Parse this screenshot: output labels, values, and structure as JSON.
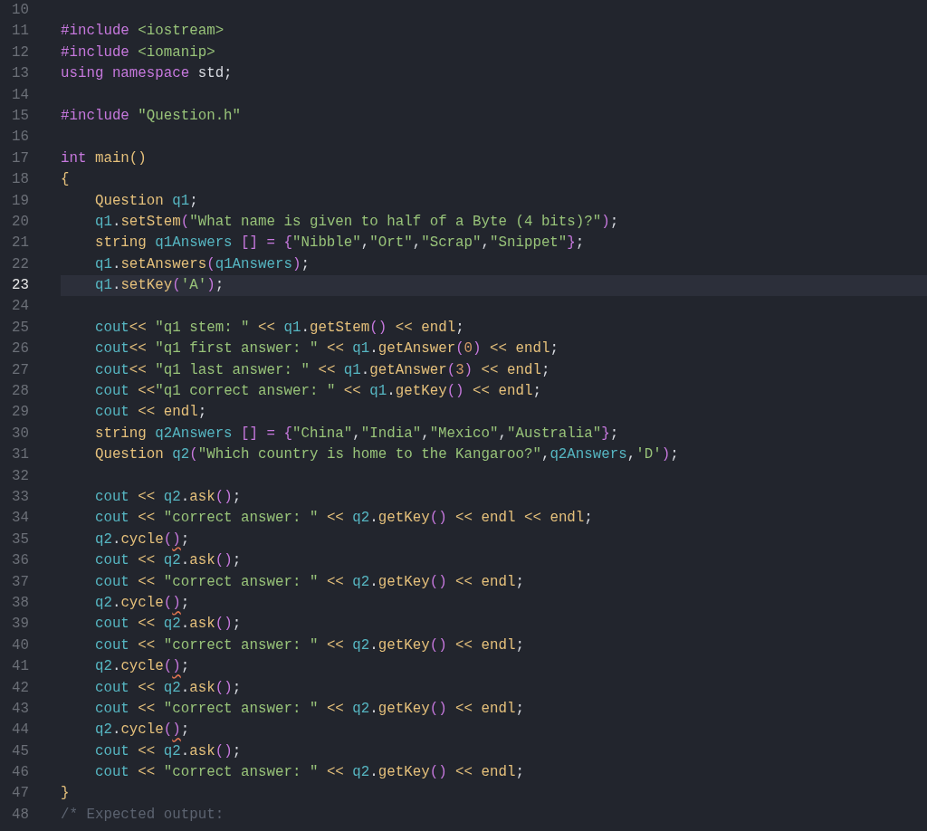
{
  "editor": {
    "lines": [
      {
        "number": "10",
        "current": false
      },
      {
        "number": "11",
        "current": false,
        "tokens": [
          {
            "kind": "kw",
            "text": "#include"
          },
          {
            "kind": "str",
            "text": " <iostream>"
          }
        ]
      },
      {
        "number": "12",
        "current": false,
        "tokens": [
          {
            "kind": "kw",
            "text": "#include"
          },
          {
            "kind": "str",
            "text": " <iomanip>"
          }
        ]
      },
      {
        "number": "13",
        "current": false,
        "tokens": [
          {
            "kind": "kw",
            "text": "using namespace"
          },
          {
            "kind": "pl",
            "text": " std;"
          }
        ]
      },
      {
        "number": "14",
        "current": false
      },
      {
        "number": "15",
        "current": false,
        "tokens": [
          {
            "kind": "kw",
            "text": "#include"
          },
          {
            "kind": "str",
            "text": " \"Question.h\""
          }
        ]
      },
      {
        "number": "16",
        "current": false
      },
      {
        "number": "17",
        "current": false,
        "tokens": [
          {
            "kind": "kw",
            "text": "int"
          },
          {
            "kind": "fn",
            "text": " main()"
          }
        ]
      },
      {
        "number": "18",
        "current": false,
        "tokens": [
          {
            "kind": "fn",
            "text": "{"
          }
        ]
      },
      {
        "number": "19",
        "current": false,
        "tokens": [
          {
            "kind": "type",
            "text": "    Question"
          },
          {
            "kind": "var",
            "text": " q1"
          },
          {
            "kind": "pl",
            "text": ";"
          }
        ]
      },
      {
        "number": "20",
        "current": false,
        "tokens": [
          {
            "kind": "var",
            "text": "    q1"
          },
          {
            "kind": "pl",
            "text": "."
          },
          {
            "kind": "fn",
            "text": "setStem"
          },
          {
            "kind": "par",
            "text": "("
          },
          {
            "kind": "str",
            "text": "\"What name is given to half of a Byte (4 bits)?\""
          },
          {
            "kind": "par",
            "text": ")"
          },
          {
            "kind": "pl",
            "text": ";"
          }
        ]
      },
      {
        "number": "21",
        "current": false,
        "tokens": [
          {
            "kind": "type",
            "text": "    string"
          },
          {
            "kind": "var",
            "text": " q1Answers"
          },
          {
            "kind": "par",
            "text": " [] = {"
          },
          {
            "kind": "str",
            "text": "\"Nibble\""
          },
          {
            "kind": "pl",
            "text": ","
          },
          {
            "kind": "str",
            "text": "\"Ort\""
          },
          {
            "kind": "pl",
            "text": ","
          },
          {
            "kind": "str",
            "text": "\"Scrap\""
          },
          {
            "kind": "pl",
            "text": ","
          },
          {
            "kind": "str",
            "text": "\"Snippet\""
          },
          {
            "kind": "par",
            "text": "}"
          },
          {
            "kind": "pl",
            "text": ";"
          }
        ]
      },
      {
        "number": "22",
        "current": false,
        "tokens": [
          {
            "kind": "var",
            "text": "    q1"
          },
          {
            "kind": "pl",
            "text": "."
          },
          {
            "kind": "fn",
            "text": "setAnswers"
          },
          {
            "kind": "par",
            "text": "("
          },
          {
            "kind": "var",
            "text": "q1Answers"
          },
          {
            "kind": "par",
            "text": ")"
          },
          {
            "kind": "pl",
            "text": ";"
          }
        ]
      },
      {
        "number": "23",
        "current": true,
        "tokens": [
          {
            "kind": "var",
            "text": "    q1"
          },
          {
            "kind": "pl",
            "text": "."
          },
          {
            "kind": "fn",
            "text": "setKey"
          },
          {
            "kind": "par",
            "text": "("
          },
          {
            "kind": "str",
            "text": "'A'"
          },
          {
            "kind": "par",
            "text": ")"
          },
          {
            "kind": "pl",
            "text": ";"
          }
        ]
      },
      {
        "number": "24",
        "current": false
      },
      {
        "number": "25",
        "current": false,
        "tokens": [
          {
            "kind": "var",
            "text": "    cout"
          },
          {
            "kind": "op",
            "text": "<< "
          },
          {
            "kind": "str",
            "text": "\"q1 stem: \""
          },
          {
            "kind": "op",
            "text": " << "
          },
          {
            "kind": "var",
            "text": "q1"
          },
          {
            "kind": "pl",
            "text": "."
          },
          {
            "kind": "fn",
            "text": "getStem"
          },
          {
            "kind": "par",
            "text": "()"
          },
          {
            "kind": "op",
            "text": " << endl"
          },
          {
            "kind": "pl",
            "text": ";"
          }
        ]
      },
      {
        "number": "26",
        "current": false,
        "tokens": [
          {
            "kind": "var",
            "text": "    cout"
          },
          {
            "kind": "op",
            "text": "<< "
          },
          {
            "kind": "str",
            "text": "\"q1 first answer: \""
          },
          {
            "kind": "op",
            "text": " << "
          },
          {
            "kind": "var",
            "text": "q1"
          },
          {
            "kind": "pl",
            "text": "."
          },
          {
            "kind": "fn",
            "text": "getAnswer"
          },
          {
            "kind": "par",
            "text": "("
          },
          {
            "kind": "num",
            "text": "0"
          },
          {
            "kind": "par",
            "text": ")"
          },
          {
            "kind": "op",
            "text": " << endl"
          },
          {
            "kind": "pl",
            "text": ";"
          }
        ]
      },
      {
        "number": "27",
        "current": false,
        "tokens": [
          {
            "kind": "var",
            "text": "    cout"
          },
          {
            "kind": "op",
            "text": "<< "
          },
          {
            "kind": "str",
            "text": "\"q1 last answer: \""
          },
          {
            "kind": "op",
            "text": " << "
          },
          {
            "kind": "var",
            "text": "q1"
          },
          {
            "kind": "pl",
            "text": "."
          },
          {
            "kind": "fn",
            "text": "getAnswer"
          },
          {
            "kind": "par",
            "text": "("
          },
          {
            "kind": "num",
            "text": "3"
          },
          {
            "kind": "par",
            "text": ")"
          },
          {
            "kind": "op",
            "text": " << endl"
          },
          {
            "kind": "pl",
            "text": ";"
          }
        ]
      },
      {
        "number": "28",
        "current": false,
        "tokens": [
          {
            "kind": "var",
            "text": "    cout"
          },
          {
            "kind": "op",
            "text": " <<"
          },
          {
            "kind": "str",
            "text": "\"q1 correct answer: \""
          },
          {
            "kind": "op",
            "text": " << "
          },
          {
            "kind": "var",
            "text": "q1"
          },
          {
            "kind": "pl",
            "text": "."
          },
          {
            "kind": "fn",
            "text": "getKey"
          },
          {
            "kind": "par",
            "text": "()"
          },
          {
            "kind": "op",
            "text": " << endl"
          },
          {
            "kind": "pl",
            "text": ";"
          }
        ]
      },
      {
        "number": "29",
        "current": false,
        "tokens": [
          {
            "kind": "var",
            "text": "    cout"
          },
          {
            "kind": "op",
            "text": " << endl"
          },
          {
            "kind": "pl",
            "text": ";"
          }
        ]
      },
      {
        "number": "30",
        "current": false,
        "tokens": [
          {
            "kind": "type",
            "text": "    string"
          },
          {
            "kind": "var",
            "text": " q2Answers"
          },
          {
            "kind": "par",
            "text": " [] = {"
          },
          {
            "kind": "str",
            "text": "\"China\""
          },
          {
            "kind": "pl",
            "text": ","
          },
          {
            "kind": "str",
            "text": "\"India\""
          },
          {
            "kind": "pl",
            "text": ","
          },
          {
            "kind": "str",
            "text": "\"Mexico\""
          },
          {
            "kind": "pl",
            "text": ","
          },
          {
            "kind": "str",
            "text": "\"Australia\""
          },
          {
            "kind": "par",
            "text": "}"
          },
          {
            "kind": "pl",
            "text": ";"
          }
        ]
      },
      {
        "number": "31",
        "current": false,
        "tokens": [
          {
            "kind": "type",
            "text": "    Question"
          },
          {
            "kind": "var",
            "text": " q2"
          },
          {
            "kind": "par",
            "text": "("
          },
          {
            "kind": "str",
            "text": "\"Which country is home to the Kangaroo?\""
          },
          {
            "kind": "pl",
            "text": ","
          },
          {
            "kind": "var",
            "text": "q2Answers"
          },
          {
            "kind": "pl",
            "text": ","
          },
          {
            "kind": "str",
            "text": "'D'"
          },
          {
            "kind": "par",
            "text": ")"
          },
          {
            "kind": "pl",
            "text": ";"
          }
        ]
      },
      {
        "number": "32",
        "current": false
      },
      {
        "number": "33",
        "current": false,
        "tokens": [
          {
            "kind": "var",
            "text": "    cout"
          },
          {
            "kind": "op",
            "text": " << "
          },
          {
            "kind": "var",
            "text": "q2"
          },
          {
            "kind": "pl",
            "text": "."
          },
          {
            "kind": "fn",
            "text": "ask"
          },
          {
            "kind": "par",
            "text": "()"
          },
          {
            "kind": "pl",
            "text": ";"
          }
        ]
      },
      {
        "number": "34",
        "current": false,
        "tokens": [
          {
            "kind": "var",
            "text": "    cout"
          },
          {
            "kind": "op",
            "text": " << "
          },
          {
            "kind": "str",
            "text": "\"correct answer: \""
          },
          {
            "kind": "op",
            "text": " << "
          },
          {
            "kind": "var",
            "text": "q2"
          },
          {
            "kind": "pl",
            "text": "."
          },
          {
            "kind": "fn",
            "text": "getKey"
          },
          {
            "kind": "par",
            "text": "()"
          },
          {
            "kind": "op",
            "text": " << endl << endl"
          },
          {
            "kind": "pl",
            "text": ";"
          }
        ]
      },
      {
        "number": "35",
        "current": false,
        "tokens": [
          {
            "kind": "var",
            "text": "    q2"
          },
          {
            "kind": "pl",
            "text": "."
          },
          {
            "kind": "fn",
            "text": "cycle"
          },
          {
            "kind": "par",
            "text": "("
          },
          {
            "kind": "par",
            "text": ")",
            "warning": true
          },
          {
            "kind": "pl",
            "text": ";"
          }
        ]
      },
      {
        "number": "36",
        "current": false,
        "tokens": [
          {
            "kind": "var",
            "text": "    cout"
          },
          {
            "kind": "op",
            "text": " << "
          },
          {
            "kind": "var",
            "text": "q2"
          },
          {
            "kind": "pl",
            "text": "."
          },
          {
            "kind": "fn",
            "text": "ask"
          },
          {
            "kind": "par",
            "text": "()"
          },
          {
            "kind": "pl",
            "text": ";"
          }
        ]
      },
      {
        "number": "37",
        "current": false,
        "tokens": [
          {
            "kind": "var",
            "text": "    cout"
          },
          {
            "kind": "op",
            "text": " << "
          },
          {
            "kind": "str",
            "text": "\"correct answer: \""
          },
          {
            "kind": "op",
            "text": " << "
          },
          {
            "kind": "var",
            "text": "q2"
          },
          {
            "kind": "pl",
            "text": "."
          },
          {
            "kind": "fn",
            "text": "getKey"
          },
          {
            "kind": "par",
            "text": "()"
          },
          {
            "kind": "op",
            "text": " << endl"
          },
          {
            "kind": "pl",
            "text": ";"
          }
        ]
      },
      {
        "number": "38",
        "current": false,
        "tokens": [
          {
            "kind": "var",
            "text": "    q2"
          },
          {
            "kind": "pl",
            "text": "."
          },
          {
            "kind": "fn",
            "text": "cycle"
          },
          {
            "kind": "par",
            "text": "("
          },
          {
            "kind": "par",
            "text": ")",
            "warning": true
          },
          {
            "kind": "pl",
            "text": ";"
          }
        ]
      },
      {
        "number": "39",
        "current": false,
        "tokens": [
          {
            "kind": "var",
            "text": "    cout"
          },
          {
            "kind": "op",
            "text": " << "
          },
          {
            "kind": "var",
            "text": "q2"
          },
          {
            "kind": "pl",
            "text": "."
          },
          {
            "kind": "fn",
            "text": "ask"
          },
          {
            "kind": "par",
            "text": "()"
          },
          {
            "kind": "pl",
            "text": ";"
          }
        ]
      },
      {
        "number": "40",
        "current": false,
        "tokens": [
          {
            "kind": "var",
            "text": "    cout"
          },
          {
            "kind": "op",
            "text": " << "
          },
          {
            "kind": "str",
            "text": "\"correct answer: \""
          },
          {
            "kind": "op",
            "text": " << "
          },
          {
            "kind": "var",
            "text": "q2"
          },
          {
            "kind": "pl",
            "text": "."
          },
          {
            "kind": "fn",
            "text": "getKey"
          },
          {
            "kind": "par",
            "text": "()"
          },
          {
            "kind": "op",
            "text": " << endl"
          },
          {
            "kind": "pl",
            "text": ";"
          }
        ]
      },
      {
        "number": "41",
        "current": false,
        "tokens": [
          {
            "kind": "var",
            "text": "    q2"
          },
          {
            "kind": "pl",
            "text": "."
          },
          {
            "kind": "fn",
            "text": "cycle"
          },
          {
            "kind": "par",
            "text": "("
          },
          {
            "kind": "par",
            "text": ")",
            "warning": true
          },
          {
            "kind": "pl",
            "text": ";"
          }
        ]
      },
      {
        "number": "42",
        "current": false,
        "tokens": [
          {
            "kind": "var",
            "text": "    cout"
          },
          {
            "kind": "op",
            "text": " << "
          },
          {
            "kind": "var",
            "text": "q2"
          },
          {
            "kind": "pl",
            "text": "."
          },
          {
            "kind": "fn",
            "text": "ask"
          },
          {
            "kind": "par",
            "text": "()"
          },
          {
            "kind": "pl",
            "text": ";"
          }
        ]
      },
      {
        "number": "43",
        "current": false,
        "tokens": [
          {
            "kind": "var",
            "text": "    cout"
          },
          {
            "kind": "op",
            "text": " << "
          },
          {
            "kind": "str",
            "text": "\"correct answer: \""
          },
          {
            "kind": "op",
            "text": " << "
          },
          {
            "kind": "var",
            "text": "q2"
          },
          {
            "kind": "pl",
            "text": "."
          },
          {
            "kind": "fn",
            "text": "getKey"
          },
          {
            "kind": "par",
            "text": "()"
          },
          {
            "kind": "op",
            "text": " << endl"
          },
          {
            "kind": "pl",
            "text": ";"
          }
        ]
      },
      {
        "number": "44",
        "current": false,
        "tokens": [
          {
            "kind": "var",
            "text": "    q2"
          },
          {
            "kind": "pl",
            "text": "."
          },
          {
            "kind": "fn",
            "text": "cycle"
          },
          {
            "kind": "par",
            "text": "("
          },
          {
            "kind": "par",
            "text": ")",
            "warning": true
          },
          {
            "kind": "pl",
            "text": ";"
          }
        ]
      },
      {
        "number": "45",
        "current": false,
        "tokens": [
          {
            "kind": "var",
            "text": "    cout"
          },
          {
            "kind": "op",
            "text": " << "
          },
          {
            "kind": "var",
            "text": "q2"
          },
          {
            "kind": "pl",
            "text": "."
          },
          {
            "kind": "fn",
            "text": "ask"
          },
          {
            "kind": "par",
            "text": "()"
          },
          {
            "kind": "pl",
            "text": ";"
          }
        ]
      },
      {
        "number": "46",
        "current": false,
        "tokens": [
          {
            "kind": "var",
            "text": "    cout"
          },
          {
            "kind": "op",
            "text": " << "
          },
          {
            "kind": "str",
            "text": "\"correct answer: \""
          },
          {
            "kind": "op",
            "text": " << "
          },
          {
            "kind": "var",
            "text": "q2"
          },
          {
            "kind": "pl",
            "text": "."
          },
          {
            "kind": "fn",
            "text": "getKey"
          },
          {
            "kind": "par",
            "text": "()"
          },
          {
            "kind": "op",
            "text": " << endl"
          },
          {
            "kind": "pl",
            "text": ";"
          }
        ]
      },
      {
        "number": "47",
        "current": false,
        "tokens": [
          {
            "kind": "fn",
            "text": "}"
          }
        ]
      },
      {
        "number": "48",
        "current": false,
        "tokens": [
          {
            "kind": "cm",
            "text": "/* Expected output:"
          }
        ]
      }
    ]
  }
}
